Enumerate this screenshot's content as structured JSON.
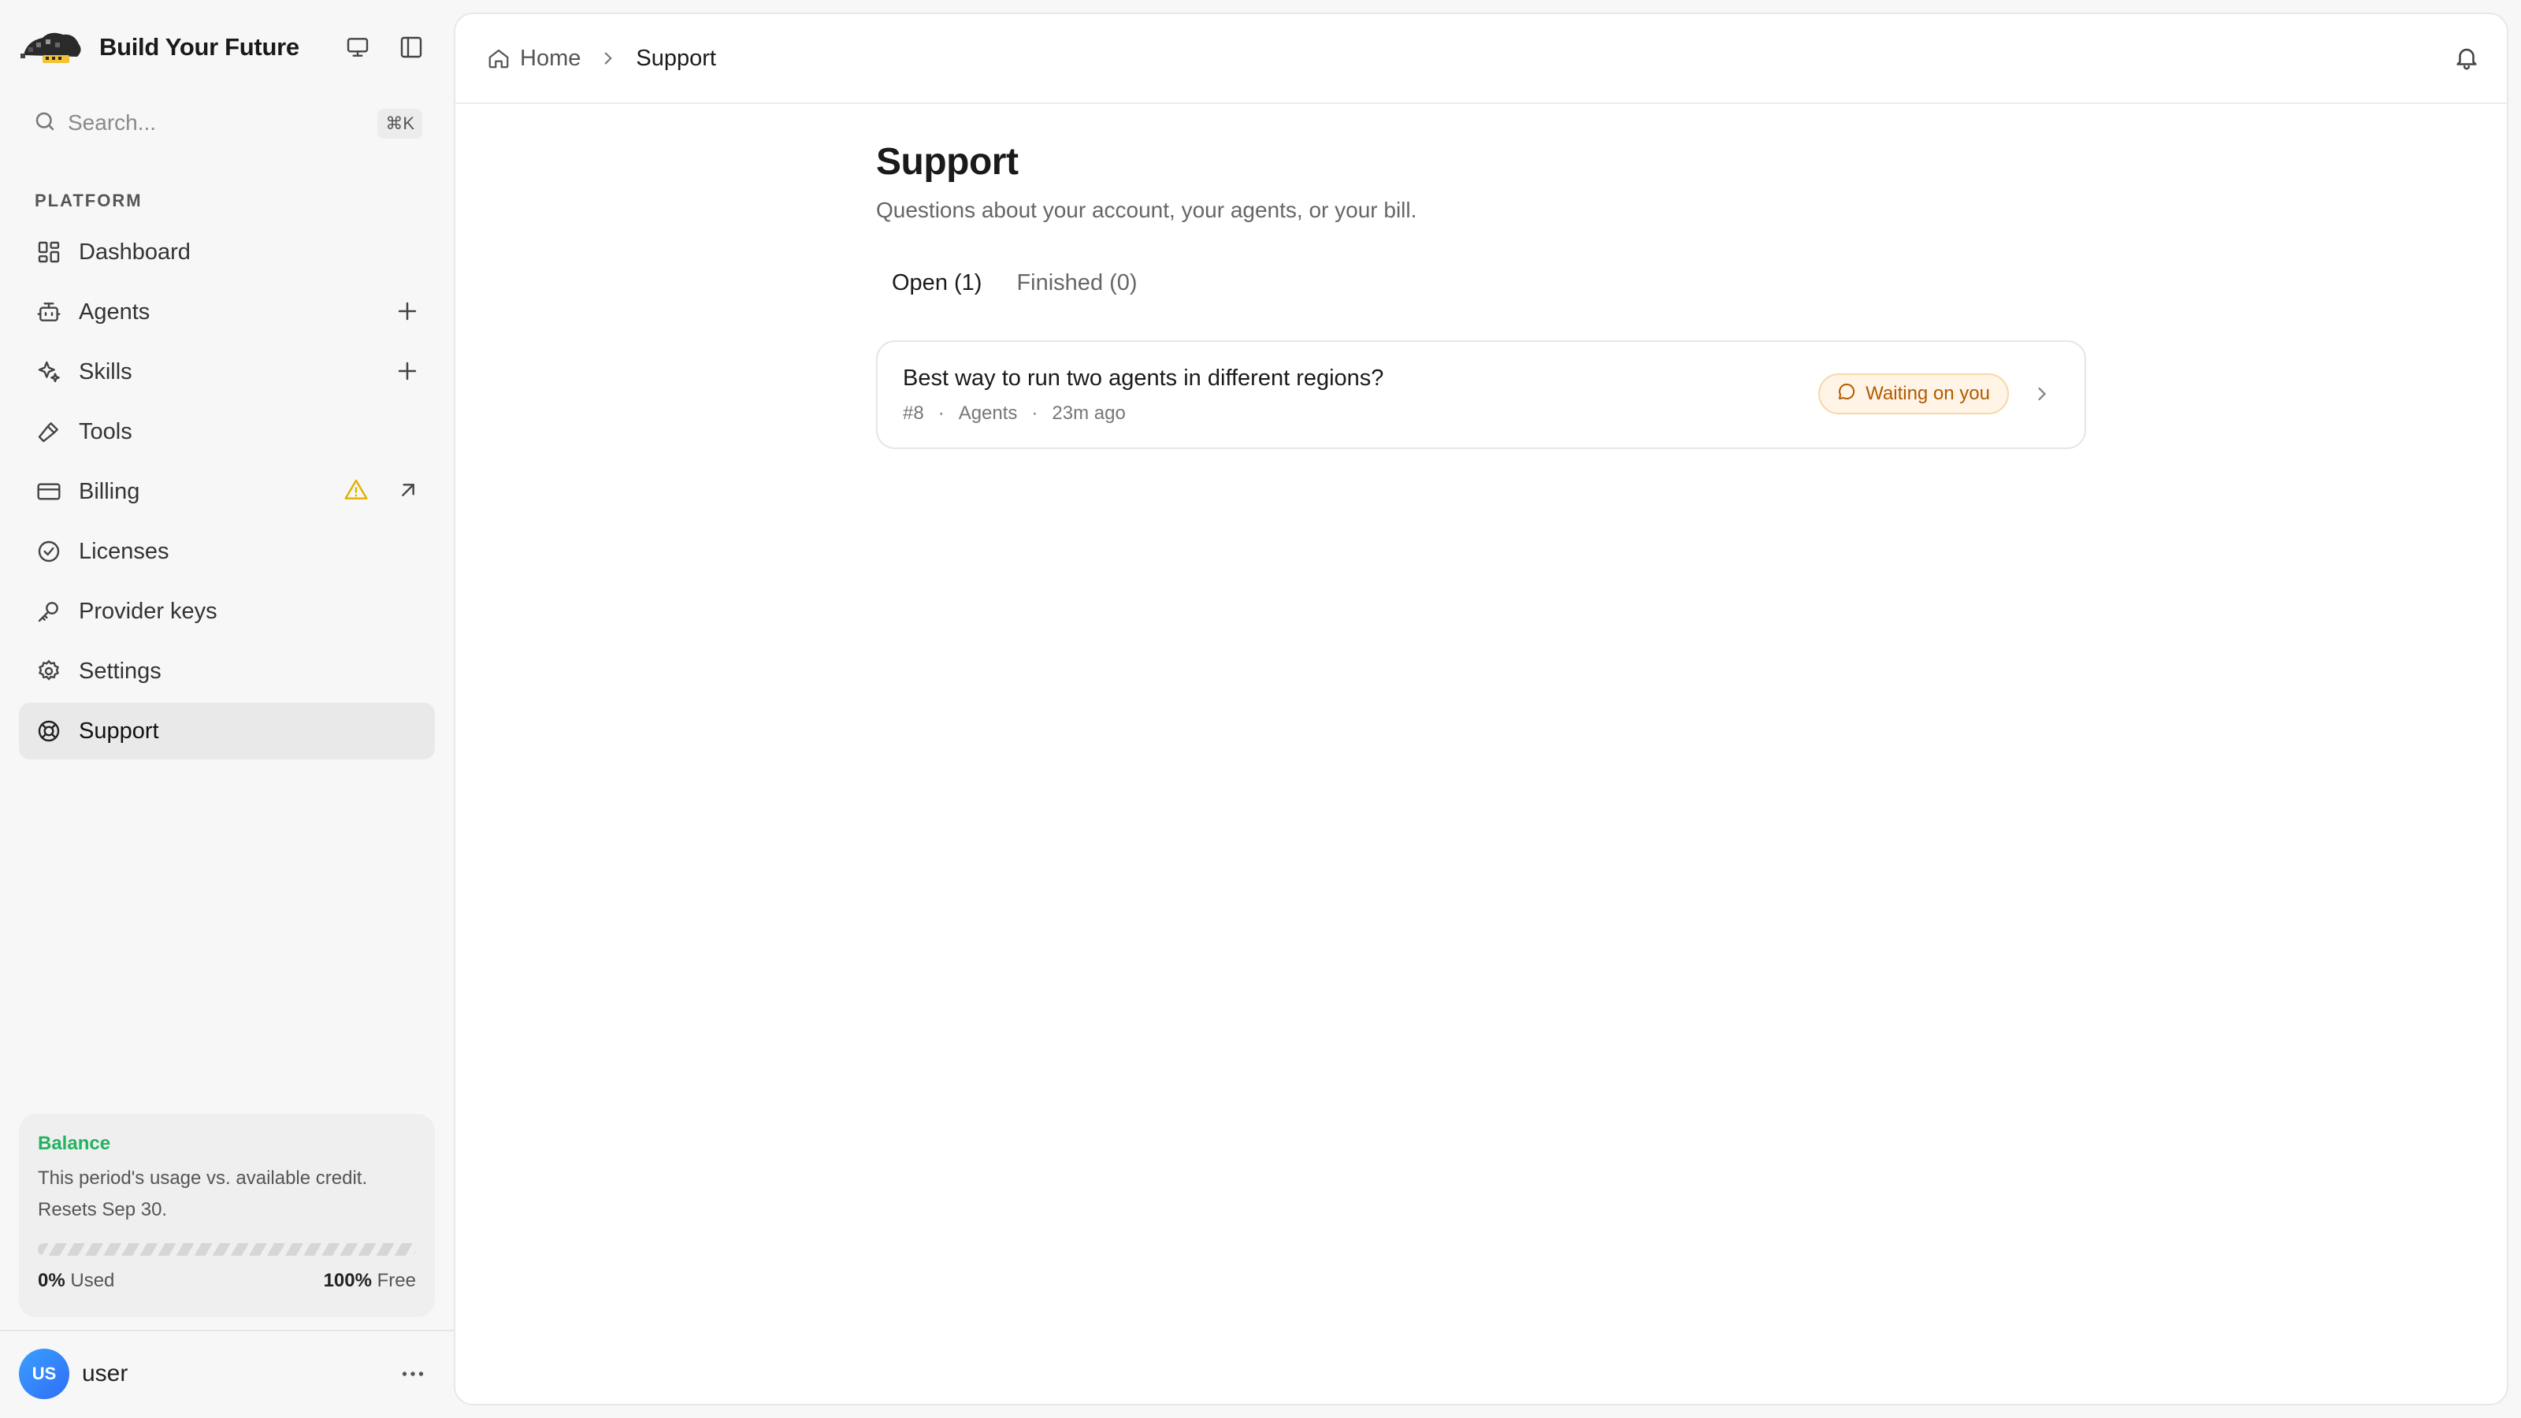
{
  "app": {
    "brand_title": "Build Your Future"
  },
  "search": {
    "placeholder": "Search...",
    "shortcut": "⌘K"
  },
  "sidebar": {
    "section_label": "PLATFORM",
    "items": [
      {
        "label": "Dashboard",
        "icon": "dashboard-icon",
        "active": false
      },
      {
        "label": "Agents",
        "icon": "robot-icon",
        "active": false,
        "action": "plus-icon"
      },
      {
        "label": "Skills",
        "icon": "sparkle-icon",
        "active": false,
        "action": "plus-icon"
      },
      {
        "label": "Tools",
        "icon": "hammer-icon",
        "active": false
      },
      {
        "label": "Billing",
        "icon": "credit-card-icon",
        "active": false,
        "warning": "warning-icon",
        "action": "external-arrow-icon"
      },
      {
        "label": "Licenses",
        "icon": "check-badge-icon",
        "active": false
      },
      {
        "label": "Provider keys",
        "icon": "key-icon",
        "active": false
      },
      {
        "label": "Settings",
        "icon": "gear-icon",
        "active": false
      },
      {
        "label": "Support",
        "icon": "lifebuoy-icon",
        "active": true
      }
    ]
  },
  "balance": {
    "title": "Balance",
    "description": "This period's usage vs. available credit. Resets Sep 30.",
    "used_percent": 0,
    "used_value": "0%",
    "used_label": "Used",
    "free_value": "100%",
    "free_label": "Free",
    "accent_color": "#22b35e"
  },
  "user": {
    "initials": "US",
    "name": "user"
  },
  "breadcrumb": {
    "home": "Home",
    "current": "Support"
  },
  "page": {
    "title": "Support",
    "subtitle": "Questions about your account, your agents, or your bill."
  },
  "tabs": [
    {
      "label": "Open (1)",
      "active": true
    },
    {
      "label": "Finished (0)",
      "active": false
    }
  ],
  "tickets": [
    {
      "title": "Best way to run two agents in different regions?",
      "id": "#8",
      "category": "Agents",
      "time": "23m ago",
      "status": "Waiting on you",
      "status_color": "#b25a00"
    }
  ],
  "meta_separator": "·"
}
